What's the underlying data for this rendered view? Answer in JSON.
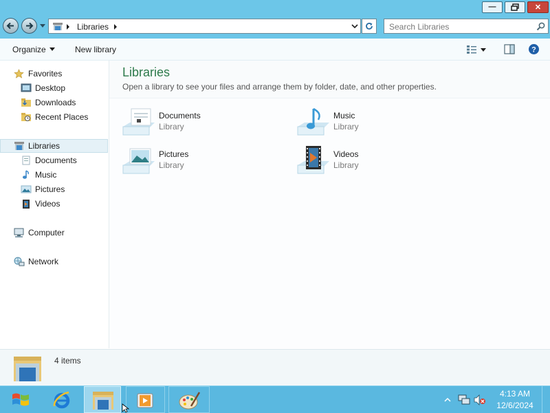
{
  "window": {
    "title": "Libraries"
  },
  "address": {
    "crumb": "Libraries",
    "search_placeholder": "Search Libraries"
  },
  "toolbar": {
    "organize_label": "Organize",
    "new_library_label": "New library"
  },
  "nav": {
    "favorites": "Favorites",
    "favorites_items": [
      "Desktop",
      "Downloads",
      "Recent Places"
    ],
    "libraries": "Libraries",
    "libraries_items": [
      "Documents",
      "Music",
      "Pictures",
      "Videos"
    ],
    "computer": "Computer",
    "network": "Network"
  },
  "content": {
    "title": "Libraries",
    "subtitle": "Open a library to see your files and arrange them by folder, date, and other properties.",
    "items": [
      {
        "name": "Documents",
        "type": "Library",
        "icon": "documents-library-icon"
      },
      {
        "name": "Music",
        "type": "Library",
        "icon": "music-library-icon"
      },
      {
        "name": "Pictures",
        "type": "Library",
        "icon": "pictures-library-icon"
      },
      {
        "name": "Videos",
        "type": "Library",
        "icon": "videos-library-icon"
      }
    ]
  },
  "details": {
    "count": "4 items"
  },
  "taskbar": {
    "time": "4:13 AM",
    "date": "12/6/2024"
  },
  "colors": {
    "accent": "#6cc6e8",
    "title_green": "#2d7a4b",
    "taskbar": "#5ab8e0"
  }
}
